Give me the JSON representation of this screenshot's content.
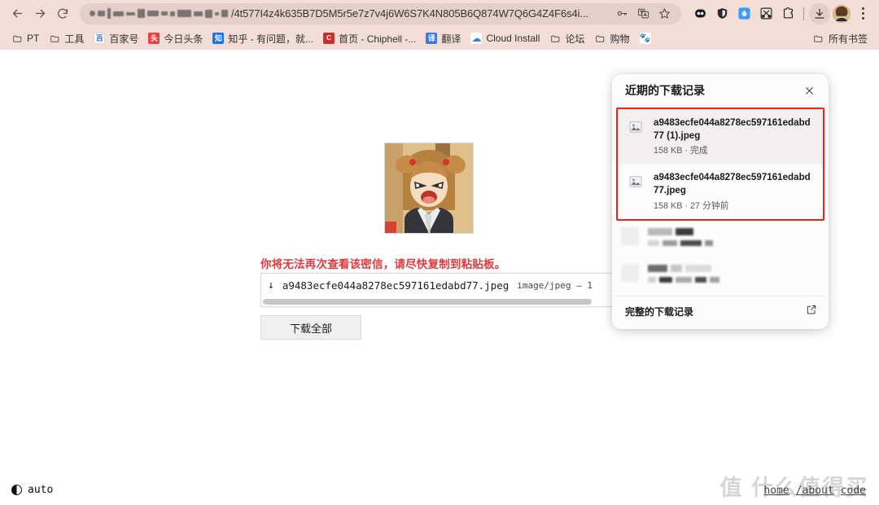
{
  "browser": {
    "nav": {
      "back": "back-arrow",
      "forward": "forward-arrow",
      "reload": "reload-icon"
    },
    "omnibox": {
      "url_visible_text": "/4t577I4z4k635B7D5M5r5e7z7v4j6W6S7K4N805B6Q874W7Q6G4Z4F6s4i...",
      "key_icon": "key-icon",
      "translate_icon": "translate-icon",
      "bookmark_star_icon": "star-icon"
    },
    "extensions": [
      {
        "name": "extension-bitwarden",
        "glyph": "bitwarden-icon"
      },
      {
        "name": "extension-shield",
        "glyph": "shield-icon"
      },
      {
        "name": "extension-blue",
        "glyph": "blue-drop-icon"
      },
      {
        "name": "extension-scissors",
        "glyph": "scissors-icon"
      },
      {
        "name": "extension-puzzle",
        "glyph": "puzzle-icon"
      }
    ],
    "download_button": "download-icon",
    "profile_avatar": "user-avatar",
    "menu": "three-dot-menu"
  },
  "bookmarks": {
    "items": [
      {
        "label": "PT",
        "icon": "folder",
        "color": "#5a514e",
        "text": ""
      },
      {
        "label": "工具",
        "icon": "folder",
        "color": "#5a514e",
        "text": ""
      },
      {
        "label": "百家号",
        "icon": "site",
        "color": "#ffffff",
        "text": "百",
        "fg": "#2f6fe0"
      },
      {
        "label": "今日头条",
        "icon": "site",
        "color": "#ef3e3e",
        "text": "头",
        "fg": "#ffffff"
      },
      {
        "label": "知乎 - 有问题，就...",
        "icon": "site",
        "color": "#1772f6",
        "text": "知",
        "fg": "#ffffff"
      },
      {
        "label": "首页 - Chiphell -...",
        "icon": "site",
        "color": "#c8312e",
        "text": "C",
        "fg": "#ffffff"
      },
      {
        "label": "翻译",
        "icon": "site",
        "color": "#3c7ae4",
        "text": "译",
        "fg": "#ffffff"
      },
      {
        "label": "Cloud Install",
        "icon": "site",
        "color": "#ffffff",
        "text": "☁",
        "fg": "#2e86de"
      },
      {
        "label": "论坛",
        "icon": "folder",
        "color": "#5a514e",
        "text": ""
      },
      {
        "label": "购物",
        "icon": "folder",
        "color": "#5a514e",
        "text": ""
      },
      {
        "label": "",
        "icon": "site",
        "color": "#ffffff",
        "text": "🐾",
        "fg": "#2b5fd9"
      }
    ],
    "all_bookmarks_label": "所有书签",
    "all_bookmarks_icon": "folder-icon"
  },
  "page": {
    "thumbnail_alt": "anime-character-thumbnail",
    "warning": "你将无法再次查看该密信，请尽快复制到粘贴板。",
    "file_row": {
      "arrow": "↓",
      "name": "a9483ecfe044a8278ec597161edabd77.jpeg",
      "meta": "image/jpeg — 1"
    },
    "download_all_label": "下载全部",
    "footer": {
      "theme_label": "auto",
      "theme_icon": "half-circle-icon",
      "links": [
        "home",
        "/about",
        "code"
      ],
      "watermark": "值 什么值得买"
    }
  },
  "downloads_popup": {
    "title": "近期的下载记录",
    "close_icon": "close-icon",
    "highlight_color": "#ff1d16",
    "items": [
      {
        "name": "a9483ecfe044a8278ec597161edabd77 (1).jpeg",
        "sub": "158 KB · 完成",
        "selected": true,
        "icon": "image-file-icon"
      },
      {
        "name": "a9483ecfe044a8278ec597161edabd77.jpeg",
        "sub": "158 KB · 27 分钟前",
        "selected": false,
        "icon": "image-file-icon"
      }
    ],
    "footer_label": "完整的下载记录",
    "footer_icon": "open-external-icon"
  }
}
